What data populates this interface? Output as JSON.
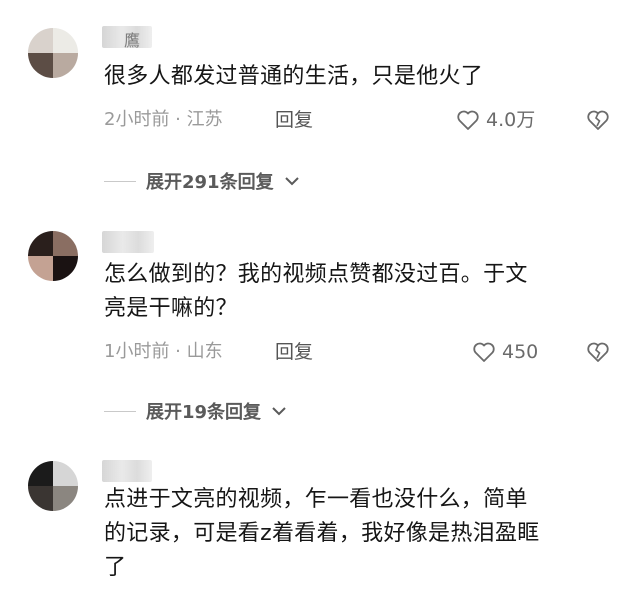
{
  "comments": [
    {
      "username": "鷹",
      "text": "很多人都发过普通的生活，只是他火了",
      "time_location": "2小时前 · 江苏",
      "reply_label": "回复",
      "likes": "4.0万",
      "expand_label": "展开291条回复"
    },
    {
      "username": "",
      "text_line1": "怎么做到的？我的视频点赞都没过百。于文",
      "text_line2": "亮是干嘛的？",
      "time_location": "1小时前 · 山东",
      "reply_label": "回复",
      "likes": "450",
      "expand_label": "展开19条回复"
    },
    {
      "username": "",
      "text_line1": "点进于文亮的视频，乍一看也没什么，简单",
      "text_line2": "的记录，可是看z着看着，我好像是热泪盈眶",
      "text_line3": "了"
    }
  ],
  "icons": {
    "like": "heart-outline-icon",
    "dislike": "broken-heart-icon",
    "expand": "chevron-down-icon"
  }
}
